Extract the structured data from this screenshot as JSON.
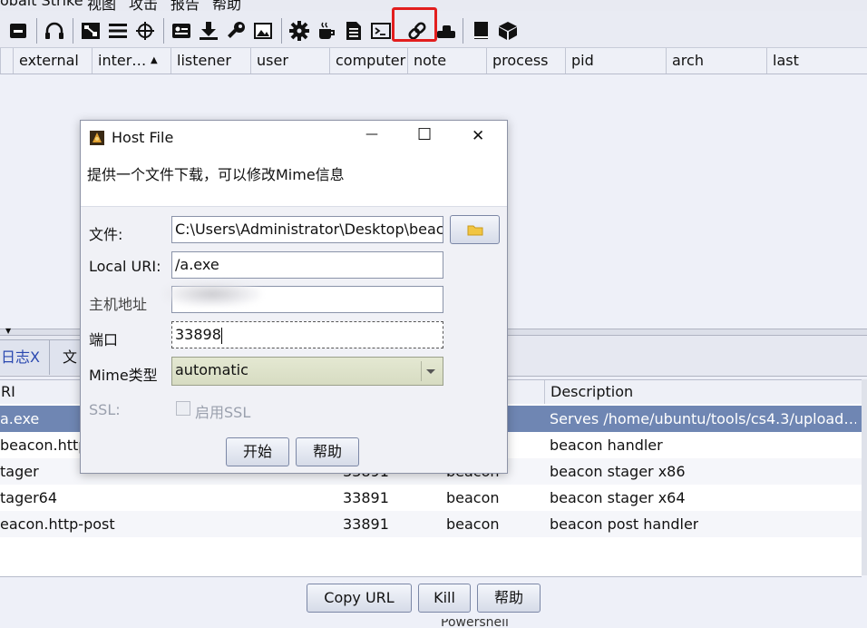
{
  "menubar": {
    "items": [
      "obalt Strike",
      "视图",
      "攻击",
      "报告",
      "帮助"
    ]
  },
  "toolbar": {
    "icons": [
      "minus-icon",
      "headphones-icon",
      "graph-icon",
      "list-icon",
      "crosshair-icon",
      "image-icon",
      "download-icon",
      "key-icon",
      "picture-icon",
      "gear-icon",
      "coffee-icon",
      "document-icon",
      "terminal-icon",
      "link-icon",
      "cloud-icon",
      "book-icon",
      "cube-icon"
    ],
    "highlight_color": "#e21e1e"
  },
  "top_table": {
    "columns": [
      "external",
      "inter…",
      "listener",
      "user",
      "computer",
      "note",
      "process",
      "pid",
      "arch",
      "last"
    ],
    "sort_indicator": "▲"
  },
  "tabs": [
    {
      "label": "日志X"
    },
    {
      "label": "文"
    }
  ],
  "splitter_arrow": "▼",
  "bottom_table": {
    "columns": [
      "RI",
      "",
      "",
      "Description"
    ],
    "rows": [
      {
        "uri": "a.exe",
        "port": "",
        "type": "",
        "description": "Serves /home/ubuntu/tools/cs4.3/upload…",
        "selected": true
      },
      {
        "uri": "beacon.http-",
        "port": "",
        "type": "",
        "description": "beacon handler",
        "selected": false
      },
      {
        "uri": "tager",
        "port": "33891",
        "type": "beacon",
        "description": "beacon stager x86",
        "selected": false
      },
      {
        "uri": "tager64",
        "port": "33891",
        "type": "beacon",
        "description": "beacon stager x64",
        "selected": false
      },
      {
        "uri": "eacon.http-post",
        "port": "33891",
        "type": "beacon",
        "description": "beacon post handler",
        "selected": false
      }
    ]
  },
  "bottom_buttons": {
    "copy_url": "Copy URL",
    "kill": "Kill",
    "help": "帮助",
    "partial_tab": "Powershell"
  },
  "dialog": {
    "title": "Host File",
    "minimize_glyph": "—",
    "maximize_glyph": "☐",
    "close_glyph": "✕",
    "description": "提供一个文件下载，可以修改Mime信息",
    "file_label": "文件:",
    "file_value": "C:\\Users\\Administrator\\Desktop\\beac",
    "local_uri_label": "Local URI:",
    "local_uri_value": "/a.exe",
    "host_label": "主机地址",
    "host_value": "",
    "port_label": "端口",
    "port_value": "33898",
    "mime_label": "Mime类型",
    "mime_value": "automatic",
    "ssl_label": "SSL:",
    "ssl_checkbox_label": "启用SSL",
    "ssl_checked": false,
    "start_button": "开始",
    "help_button": "帮助"
  }
}
